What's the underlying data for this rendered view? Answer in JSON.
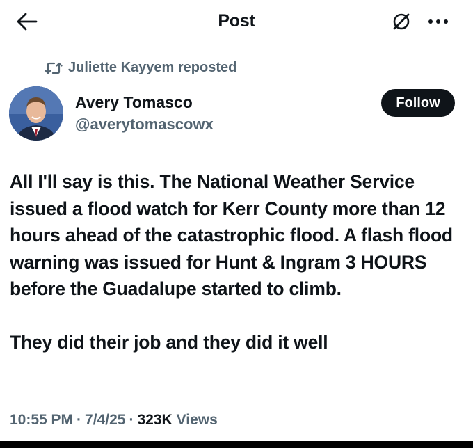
{
  "header": {
    "title": "Post",
    "back_icon": "arrow-left-icon",
    "grok_icon": "grok-icon",
    "more_icon": "more-horizontal-icon"
  },
  "repost": {
    "icon": "repost-icon",
    "label": "Juliette Kayyem reposted"
  },
  "author": {
    "name": "Avery Tomasco",
    "handle": "@averytomascowx",
    "follow_label": "Follow"
  },
  "post": {
    "text": "All I'll say is this. The National Weather Service issued a flood watch for Kerr County more than 12 hours ahead of the catastrophic flood. A flash flood warning was issued for Hunt & Ingram 3 HOURS before the Guadalupe started to climb.\n\nThey did their job and they did it well"
  },
  "meta": {
    "time": "10:55 PM",
    "date": "7/4/25",
    "separator": "·",
    "views_count": "323K",
    "views_label": "Views"
  },
  "colors": {
    "text": "#0f1419",
    "secondary": "#536471",
    "follow_bg": "#0f1419",
    "background": "#ffffff"
  }
}
